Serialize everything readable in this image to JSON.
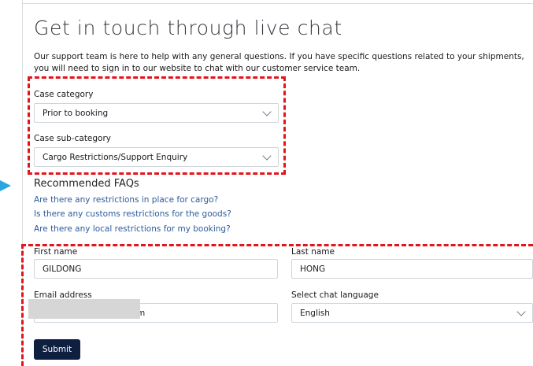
{
  "page": {
    "title": "Get in touch through live chat",
    "intro": "Our support team is here to help with any general questions. If you have specific questions related to your shipments, you will need to sign in to our website to chat with our customer service team."
  },
  "case": {
    "category_label": "Case category",
    "category_value": "Prior to booking",
    "subcategory_label": "Case sub-category",
    "subcategory_value": "Cargo Restrictions/Support Enquiry"
  },
  "faqs": {
    "title": "Recommended FAQs",
    "items": [
      "Are there any restrictions in place for cargo?",
      "Is there any customs restrictions for the goods?",
      "Are there any local restrictions for my booking?"
    ]
  },
  "form": {
    "first_name_label": "First name",
    "first_name_value": "GILDONG",
    "last_name_label": "Last name",
    "last_name_value": "HONG",
    "email_label": "Email address",
    "email_value_visible": "m",
    "language_label": "Select chat language",
    "language_value": "English",
    "submit_label": "Submit"
  },
  "colors": {
    "accent_dark": "#0e1f40",
    "link": "#2d5a9a",
    "highlight": "#e3141c",
    "pointer": "#29a8e0"
  },
  "icons": {
    "dropdown": "chevron-down-icon",
    "pointer": "triangle-right-icon"
  }
}
